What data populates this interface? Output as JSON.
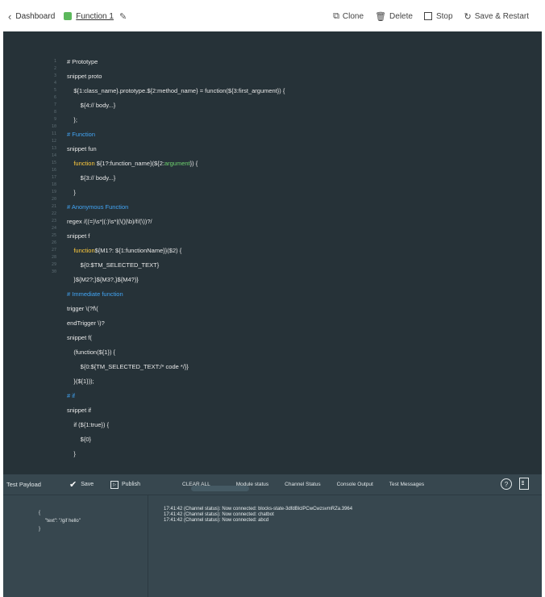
{
  "header": {
    "back_label": "Dashboard",
    "function_name": "Function 1",
    "status_color": "#5cb85c",
    "clone_label": "Clone",
    "delete_label": "Delete",
    "stop_label": "Stop",
    "save_restart_label": "Save & Restart"
  },
  "editor": {
    "line_numbers": [
      "1",
      "2",
      "3",
      "4",
      "5",
      "6",
      "7",
      "8",
      "9",
      "10",
      "11",
      "12",
      "13",
      "14",
      "15",
      "16",
      "17",
      "18",
      "19",
      "20",
      "21",
      "22",
      "23",
      "24",
      "25",
      "26",
      "27",
      "28",
      "29",
      "30"
    ],
    "lines": [
      "# Prototype",
      "snippet proto",
      "    ${1:class_name}.prototype.${2:method_name} = function(${3:first_argument}) {",
      "        ${4:// body...}",
      "    };",
      "# Function",
      "snippet fun",
      "    function ${1?:function_name}(${2:argument}) {",
      "        ${3:// body...}",
      "    }",
      "# Anonymous Function",
      "regex /((=)\\s*|(:)\\s*|(\\()|\\b)/f/(\\))?/",
      "snippet f",
      "    function${M1?: ${1:functionName}}($2) {",
      "        ${0:$TM_SELECTED_TEXT}",
      "    }${M2?;}${M3?,}${M4?)}",
      "# Immediate function",
      "trigger \\(?f\\(",
      "endTrigger \\)?",
      "snippet f(",
      "    (function(${1}) {",
      "        ${0:${TM_SELECTED_TEXT:/* code */}}",
      "    }(${1}));",
      "# if",
      "snippet if",
      "    if (${1:true}) {",
      "        ${0}",
      "    }"
    ],
    "tokens": {
      "fun_kw": "function",
      "fun_rest": " ${1?:function_name}(${2:",
      "fun_arg": "argument",
      "fun_end": "}) {",
      "f_kw": "function",
      "f_rest": "${M1?: ${1:functionName}}($2) {"
    },
    "colors": {
      "background": "#263238",
      "comment": "#42a5f5",
      "keyword": "#ffcb3d",
      "argument": "#6fd36f"
    }
  },
  "panel": {
    "title": "Test Payload",
    "save_label": "Save",
    "publish_label": "Publish",
    "tabs": [
      "CLEAR ALL",
      "Module status",
      "Channel Status",
      "Console Output",
      "Test Messages"
    ],
    "payload": [
      "{",
      "\"text\": \"/gif hello\"",
      "}"
    ],
    "console_lines": [
      "17:41:42 (Channel status): Now connected: blocks-state-3dfdBlclPCwCwzsvmRZa.3964",
      "17:41:42 (Channel status): Now connected: chatbot",
      "17:41:42 (Channel status): Now connected: abcd"
    ]
  }
}
